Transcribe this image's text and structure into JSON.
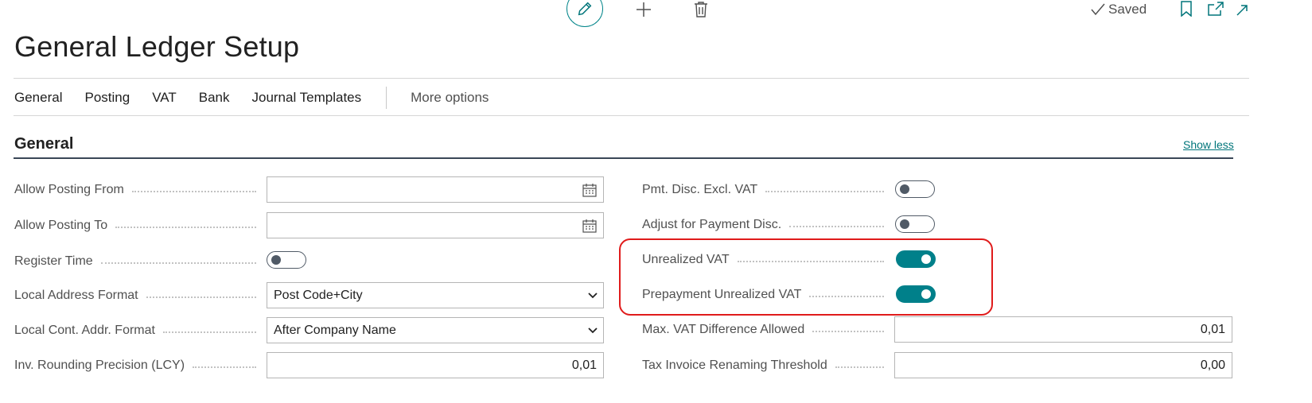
{
  "header": {
    "saved_label": "Saved",
    "page_title": "General Ledger Setup"
  },
  "nav": {
    "items": [
      "General",
      "Posting",
      "VAT",
      "Bank",
      "Journal Templates"
    ],
    "more_label": "More options"
  },
  "section": {
    "title": "General",
    "show_less_label": "Show less"
  },
  "left_fields": {
    "allow_posting_from": {
      "label": "Allow Posting From",
      "value": ""
    },
    "allow_posting_to": {
      "label": "Allow Posting To",
      "value": ""
    },
    "register_time": {
      "label": "Register Time",
      "checked": false
    },
    "local_address_format": {
      "label": "Local Address Format",
      "value": "Post Code+City"
    },
    "local_cont_addr_format": {
      "label": "Local Cont. Addr. Format",
      "value": "After Company Name"
    },
    "inv_rounding_precision": {
      "label": "Inv. Rounding Precision (LCY)",
      "value": "0,01"
    }
  },
  "right_fields": {
    "pmt_disc_excl_vat": {
      "label": "Pmt. Disc. Excl. VAT",
      "checked": false
    },
    "adjust_for_payment_disc": {
      "label": "Adjust for Payment Disc.",
      "checked": false
    },
    "unrealized_vat": {
      "label": "Unrealized VAT",
      "checked": true
    },
    "prepayment_unrealized_vat": {
      "label": "Prepayment Unrealized VAT",
      "checked": true
    },
    "max_vat_difference": {
      "label": "Max. VAT Difference Allowed",
      "value": "0,01"
    },
    "tax_invoice_renaming_threshold": {
      "label": "Tax Invoice Renaming Threshold",
      "value": "0,00"
    }
  },
  "colors": {
    "accent": "#00808a",
    "highlight_border": "#e01b1b",
    "section_line": "#3a4757"
  }
}
